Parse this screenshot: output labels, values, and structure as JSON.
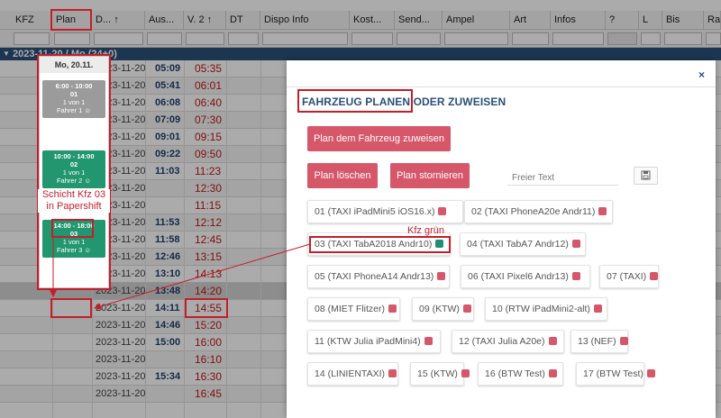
{
  "grid": {
    "columns": [
      "KFZ",
      "Plan",
      "D...",
      "Aus...",
      "V. 2",
      "DT",
      "Dispo Info",
      "Kost...",
      "Send...",
      "Ampel",
      "Art",
      "Infos",
      "?",
      "L",
      "Bis",
      "Ra"
    ],
    "sort_arrow": "↑",
    "group_label": "2023-11-20 / Mo (24+0)",
    "rows": [
      {
        "date": "2023-11-20",
        "aus": "05:09",
        "v2": "05:35"
      },
      {
        "date": "2023-11-20",
        "aus": "05:41",
        "v2": "06:01"
      },
      {
        "date": "2023-11-20",
        "aus": "06:08",
        "v2": "06:40"
      },
      {
        "date": "2023-11-20",
        "aus": "07:09",
        "v2": "07:30"
      },
      {
        "date": "2023-11-20",
        "aus": "09:01",
        "v2": "09:15"
      },
      {
        "date": "2023-11-20",
        "aus": "09:22",
        "v2": "09:50"
      },
      {
        "date": "2023-11-20",
        "aus": "11:03",
        "v2": "11:23"
      },
      {
        "date": "2023-11-20",
        "aus": "",
        "v2": "12:30"
      },
      {
        "date": "2023-11-20",
        "aus": "",
        "v2": "11:15"
      },
      {
        "date": "2023-11-20",
        "aus": "11:53",
        "v2": "12:12"
      },
      {
        "date": "2023-11-20",
        "aus": "11:58",
        "v2": "12:45"
      },
      {
        "date": "2023-11-20",
        "aus": "12:46",
        "v2": "13:15"
      },
      {
        "date": "2023-11-20",
        "aus": "13:10",
        "v2": "14:13"
      },
      {
        "date": "2023-11-20",
        "aus": "13:48",
        "v2": "14:20"
      },
      {
        "date": "2023-11-20",
        "aus": "14:11",
        "v2": "14:55"
      },
      {
        "date": "2023-11-20",
        "aus": "14:46",
        "v2": "15:20"
      },
      {
        "date": "2023-11-20",
        "aus": "15:00",
        "v2": "16:00"
      },
      {
        "date": "2023-11-20",
        "aus": "",
        "v2": "16:10"
      },
      {
        "date": "2023-11-20",
        "aus": "15:34",
        "v2": "16:30"
      },
      {
        "date": "2023-11-20",
        "aus": "",
        "v2": "16:45"
      }
    ]
  },
  "schedule": {
    "day_label": "Mo, 20.11.",
    "shifts": [
      {
        "time": "6:00 - 10:00",
        "nr": "01",
        "count": "1 von 1",
        "driver": "Fahrer 1",
        "color": "grey"
      },
      {
        "time": "10:00 - 14:00",
        "nr": "02",
        "count": "1 von 1",
        "driver": "Fahrer 2",
        "color": "green"
      },
      {
        "time": "14:00 - 18:00",
        "nr": "03",
        "count": "1 von 1",
        "driver": "Fahrer 3",
        "color": "green"
      }
    ]
  },
  "modal": {
    "close": "×",
    "title": "FAHRZEUG PLANEN ODER ZUWEISEN",
    "assign_button": "Plan dem Fahrzeug zuweisen",
    "delete_button": "Plan löschen",
    "cancel_button": "Plan stornieren",
    "free_text_placeholder": "Freier Text",
    "vehicles": [
      {
        "label": "01 (TAXI iPadMini5 iOS16.x)",
        "status": "red"
      },
      {
        "label": "02 (TAXI PhoneA20e Andr11)",
        "status": "red"
      },
      {
        "label": "03 (TAXI TabA2018 Andr10)",
        "status": "green"
      },
      {
        "label": "04 (TAXI TabA7 Andr12)",
        "status": "red"
      },
      {
        "label": "05 (TAXI PhoneA14 Andr13)",
        "status": "red"
      },
      {
        "label": "06 (TAXI Pixel6 Andr13)",
        "status": "red"
      },
      {
        "label": "07 (TAXI)",
        "status": "red"
      },
      {
        "label": "08 (MIET Flitzer)",
        "status": "red"
      },
      {
        "label": "09 (KTW)",
        "status": "red"
      },
      {
        "label": "10 (RTW iPadMini2-alt)",
        "status": "red"
      },
      {
        "label": "11 (KTW Julia iPadMini4)",
        "status": "red"
      },
      {
        "label": "12 (TAXI Julia A20e)",
        "status": "red"
      },
      {
        "label": "13 (NEF)",
        "status": "red"
      },
      {
        "label": "14 (LINIENTAXI)",
        "status": "red"
      },
      {
        "label": "15 (KTW)",
        "status": "red"
      },
      {
        "label": "16 (BTW Test)",
        "status": "red"
      },
      {
        "label": "17 (BTW Test)",
        "status": "red"
      }
    ]
  },
  "annotations": {
    "schicht_line1": "Schicht Kfz 03",
    "schicht_line2": "in Papershift",
    "kfz_gruen": "Kfz grün"
  },
  "colors": {
    "accent_blue": "#2b4f79",
    "button_red": "#d6576a",
    "status_green": "#1f8f76",
    "annotation_red": "#c41e2a",
    "time_red": "#c01818"
  }
}
